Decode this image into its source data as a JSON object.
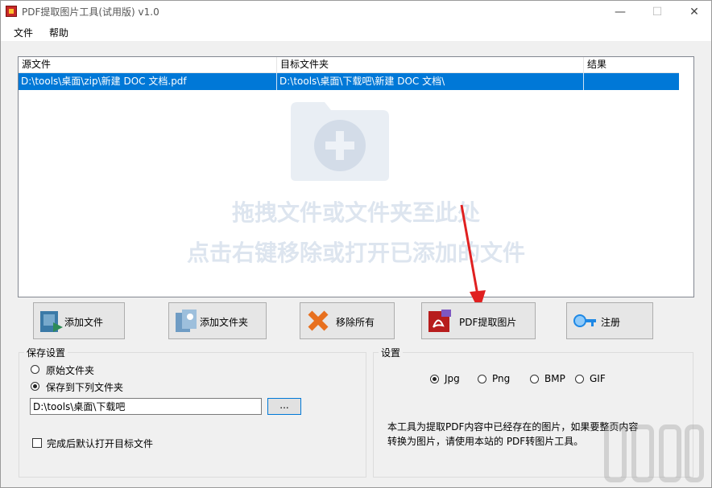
{
  "window": {
    "title": "PDF提取图片工具(试用版) v1.0",
    "minimize": "—",
    "maximize": "☐",
    "close": "✕"
  },
  "menu": {
    "file": "文件",
    "help": "帮助"
  },
  "filelist": {
    "columns": [
      "源文件",
      "目标文件夹",
      "结果"
    ],
    "rows": [
      {
        "source": "D:\\tools\\桌面\\zip\\新建 DOC 文档.pdf",
        "target": "D:\\tools\\桌面\\下载吧\\新建 DOC 文档\\",
        "result": ""
      }
    ],
    "hint_line1": "拖拽文件或文件夹至此处",
    "hint_line2": "点击右键移除或打开已添加的文件"
  },
  "buttons": {
    "add_file": "添加文件",
    "add_folder": "添加文件夹",
    "remove_all": "移除所有",
    "extract": "PDF提取图片",
    "register": "注册"
  },
  "save_settings": {
    "title": "保存设置",
    "option_original": "原始文件夹",
    "option_custom": "保存到下列文件夹",
    "selected": "custom",
    "path": "D:\\tools\\桌面\\下载吧",
    "browse_label": "...",
    "open_after": "完成后默认打开目标文件",
    "open_after_checked": false
  },
  "settings": {
    "title": "设置",
    "formats": [
      "Jpg",
      "Png",
      "BMP",
      "GIF"
    ],
    "selected_format": "Jpg",
    "note_line1": "本工具为提取PDF内容中已经存在的图片，如果要整页内容",
    "note_line2": "转换为图片，请使用本站的 PDF转图片工具。"
  },
  "colors": {
    "selection": "#0078d7",
    "arrow": "#e02020",
    "hint": "#dde5ef"
  }
}
